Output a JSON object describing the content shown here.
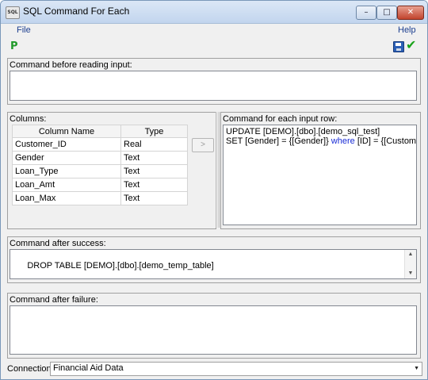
{
  "window": {
    "title": "SQL Command For Each",
    "icon": "sql-app-icon",
    "icon_text": "SQL"
  },
  "titlebar_buttons": {
    "minimize": "–",
    "maximize": "□",
    "close": "✕"
  },
  "menu": {
    "file": "File",
    "help": "Help"
  },
  "toolbar": {
    "p_label": "P",
    "save_icon": "floppy-disk-icon",
    "check_icon": "green-check-icon",
    "check_glyph": "✔"
  },
  "before": {
    "label": "Command before reading input:",
    "value": ""
  },
  "columns": {
    "label": "Columns:",
    "headers": [
      "Column Name",
      "Type"
    ],
    "rows": [
      [
        "Customer_ID",
        "Real"
      ],
      [
        "Gender",
        "Text"
      ],
      [
        "Loan_Type",
        "Text"
      ],
      [
        "Loan_Amt",
        "Text"
      ],
      [
        "Loan_Max",
        "Text"
      ]
    ],
    "move_button": ">"
  },
  "each": {
    "label": "Command for each input row:",
    "line1": "UPDATE [DEMO].[dbo].[demo_sql_test]",
    "line2_a": "SET [Gender] = {[Gender]} ",
    "line2_kw": "where",
    "line2_b": " [ID] = {[Customer_ID]}"
  },
  "success": {
    "label": "Command after success:",
    "value": "DROP TABLE [DEMO].[dbo].[demo_temp_table]"
  },
  "failure": {
    "label": "Command after failure:",
    "value": ""
  },
  "connection": {
    "label": "Connection:",
    "value": "Financial Aid Data"
  }
}
